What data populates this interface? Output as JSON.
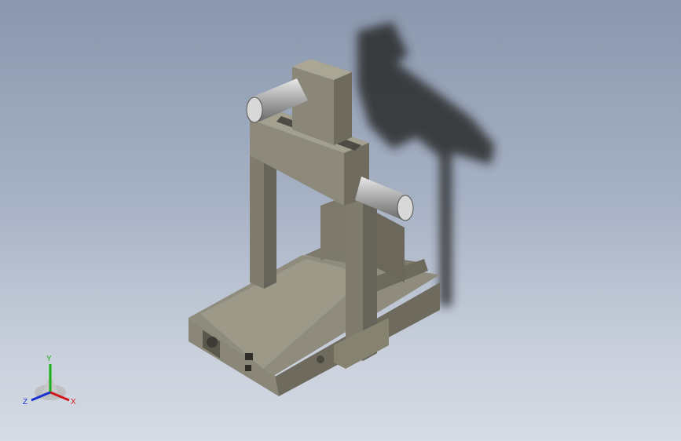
{
  "triad": {
    "x_label": "X",
    "y_label": "Y",
    "z_label": "Z",
    "x_color": "#d01818",
    "y_color": "#18b018",
    "z_color": "#1830d0"
  },
  "colors": {
    "body": "#7f7c6e",
    "body_light": "#9a9788",
    "body_dark": "#5e5b50",
    "motor": "#b4b4b4",
    "shadow": "#2a2a2a"
  }
}
